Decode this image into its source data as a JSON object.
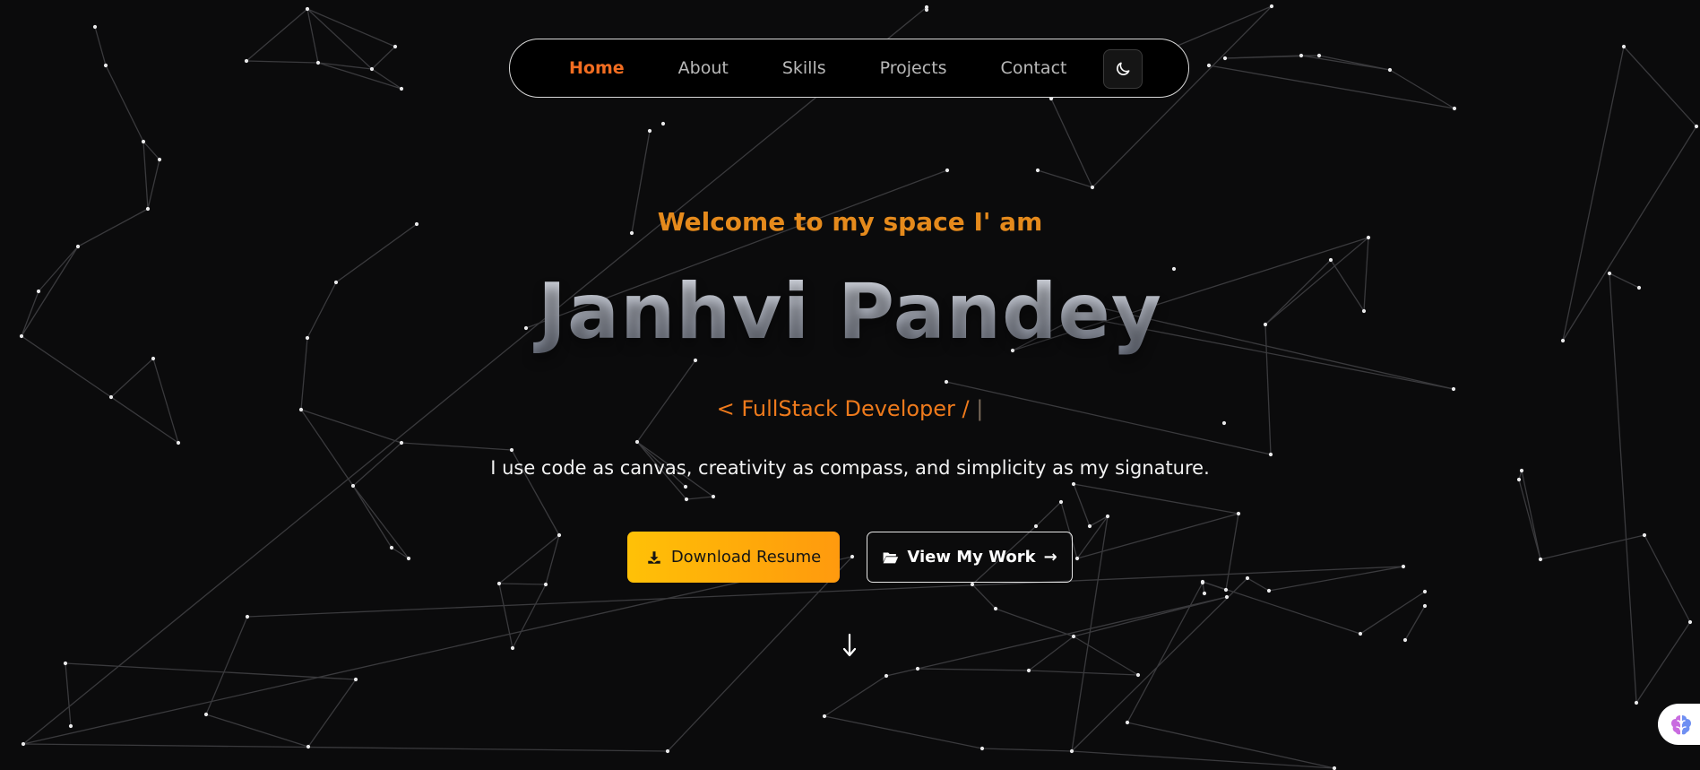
{
  "nav": {
    "links": [
      {
        "label": "Home",
        "active": true
      },
      {
        "label": "About",
        "active": false
      },
      {
        "label": "Skills",
        "active": false
      },
      {
        "label": "Projects",
        "active": false
      },
      {
        "label": "Contact",
        "active": false
      }
    ],
    "theme_toggle_icon": "moon-icon"
  },
  "hero": {
    "welcome": "Welcome to my space I' am",
    "name": "Janhvi Pandey",
    "role": "< FullStack Developer /",
    "role_cursor": "|",
    "tagline": "I use code as canvas, creativity as compass, and simplicity as my signature.",
    "primary_button": {
      "label": "Download Resume",
      "icon": "download-icon"
    },
    "secondary_button": {
      "label": "View My Work",
      "icon": "folder-open-icon",
      "trailing": "→"
    },
    "scroll_icon": "arrow-down-icon"
  },
  "widget": {
    "icon": "brain-icon"
  },
  "colors": {
    "background": "#0b0b0c",
    "accent": "#f26d21",
    "welcome": "#e58a1c",
    "button_gradient_start": "#ffc107",
    "button_gradient_end": "#ff9a0e",
    "particle": "#e9e9ea",
    "particle_line": "#3a3a3d"
  }
}
